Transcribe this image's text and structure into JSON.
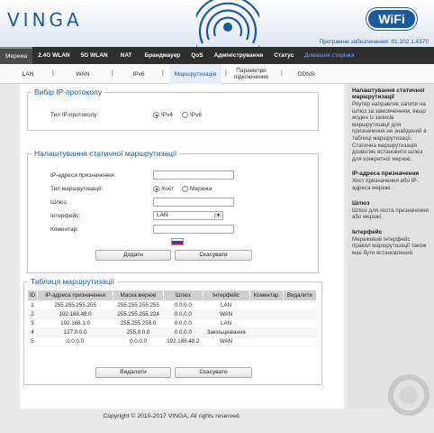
{
  "brand": {
    "logo": "VINGA",
    "wifi_badge": "WiFi"
  },
  "firmware": "Програмне забезпечення: 81.102.1.4370",
  "main_nav": [
    {
      "label": "Мережа",
      "active": true
    },
    {
      "label": "2.4G WLAN"
    },
    {
      "label": "5G WLAN"
    },
    {
      "label": "NAT"
    },
    {
      "label": "Брандмауер"
    },
    {
      "label": "QoS"
    },
    {
      "label": "Адміністрування"
    },
    {
      "label": "Статус"
    },
    {
      "label": "Домашня сторінка",
      "link": true
    }
  ],
  "sub_nav": [
    {
      "label": "LAN"
    },
    {
      "label": "WAN"
    },
    {
      "label": "IPv6"
    },
    {
      "label": "Маршрутизація",
      "active": true
    },
    {
      "label": "Параметри підключення"
    },
    {
      "label": "DDNS"
    }
  ],
  "ip_protocol": {
    "legend": "Вибір IP-протоколу",
    "label": "Тип IP-протоколу:",
    "options": [
      "IPv4",
      "IPv6"
    ],
    "selected": "IPv4"
  },
  "static_routing": {
    "legend": "Налаштування статичної маршрутизації",
    "dest_label": "IP-адреса призначення:",
    "dest_value": "",
    "type_label": "Тип маршрутизації:",
    "type_options": [
      "Хост",
      "Мережа"
    ],
    "type_selected": "Хост",
    "gateway_label": "Шлюз:",
    "gateway_value": "",
    "interface_label": "Інтерфейс:",
    "interface_value": "LAN",
    "comment_label": "Коментар:",
    "comment_value": "",
    "add_button": "Додати",
    "cancel_button": "Скасувати"
  },
  "routing_table": {
    "legend": "Таблиця маршрутизації",
    "columns": [
      "ID",
      "IP-адреса призначення",
      "Маска мережі",
      "Шлюз",
      "Інтерфейс",
      "Коментар",
      "Видалити"
    ],
    "rows": [
      {
        "id": "1",
        "dest": "255.255.255.255",
        "mask": "255.255.255.255",
        "gw": "0.0.0.0",
        "iface": "LAN",
        "comment": "",
        "del": ""
      },
      {
        "id": "2",
        "dest": "192.168.48.0",
        "mask": "255.255.255.224",
        "gw": "0.0.0.0",
        "iface": "WAN",
        "comment": "",
        "del": ""
      },
      {
        "id": "3",
        "dest": "192.168.1.0",
        "mask": "255.255.255.0",
        "gw": "0.0.0.0",
        "iface": "LAN",
        "comment": "",
        "del": ""
      },
      {
        "id": "4",
        "dest": "127.0.0.0",
        "mask": "255.0.0.0",
        "gw": "0.0.0.0",
        "iface": "Закільцювання",
        "comment": "",
        "del": ""
      },
      {
        "id": "5",
        "dest": "0.0.0.0",
        "mask": "0.0.0.0",
        "gw": "192.168.48.2",
        "iface": "WAN",
        "comment": "",
        "del": ""
      }
    ],
    "delete_button": "Видалити",
    "cancel_button": "Скасувати"
  },
  "sidebar": [
    {
      "title": "Налаштування статичної маршрутизації",
      "text": "Роутер направляє запити на шлюз за замовченням, якщо жоден із записів маршрутизації для призначення не знайдений в таблиці маршрутизації. Статична маршрутизація дозволяє встановити шлюз для конкретної мережі."
    },
    {
      "title": "IP-адреса призначення",
      "text": "Хост призначення або IP-адреса мережі."
    },
    {
      "title": "Шлюз",
      "text": "Шлюз для хоста призначення або мережі."
    },
    {
      "title": "Інтерфейс",
      "text": "Мережевий інтерфейс правил маршрутизації також має бути встановлений."
    }
  ],
  "footer": "Copyright © 2010-2017 VINGA, All rights reserved.",
  "colors": {
    "brand_blue": "#1b5a9e",
    "nav_bg": "#2e2e2e",
    "sidebar_bg": "#e2e2e2"
  }
}
